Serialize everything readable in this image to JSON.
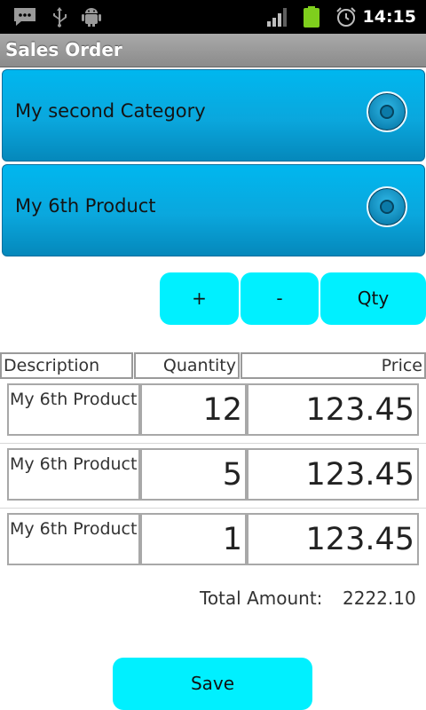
{
  "status_bar": {
    "time": "14:15",
    "icons": [
      "message-icon",
      "usb-icon",
      "android-debug-icon",
      "signal-icon",
      "battery-icon",
      "alarm-icon"
    ]
  },
  "title_bar": {
    "title": "Sales Order"
  },
  "category_spinner": {
    "value": "My second Category"
  },
  "product_spinner": {
    "value": "My 6th Product"
  },
  "actions": {
    "plus": "+",
    "minus": "-",
    "qty": "Qty"
  },
  "table": {
    "headers": [
      "Description",
      "Quantity",
      "Price"
    ],
    "rows": [
      {
        "description": "My 6th Product",
        "quantity": "12",
        "price": "123.45"
      },
      {
        "description": "My 6th Product",
        "quantity": "5",
        "price": "123.45"
      },
      {
        "description": "My 6th Product",
        "quantity": "1",
        "price": "123.45"
      }
    ]
  },
  "total": {
    "label": "Total Amount:",
    "value": "2222.10"
  },
  "save": {
    "label": "Save"
  },
  "colors": {
    "accent_button": "#00f0ff",
    "spinner_blue": "#0aa7dd",
    "status_bar": "#000000",
    "title_bar": "#999999"
  }
}
